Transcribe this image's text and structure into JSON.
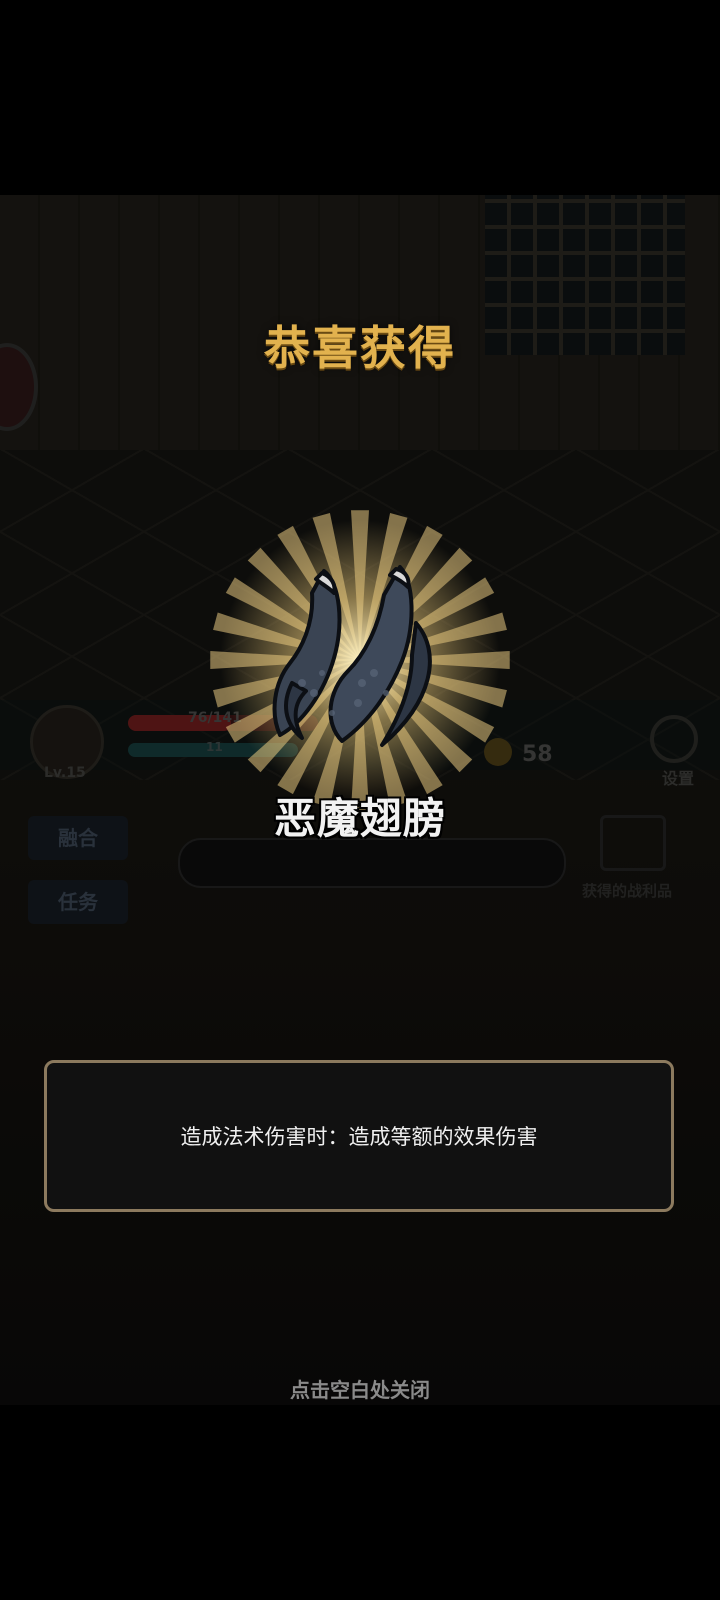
{
  "popup": {
    "title": "恭喜获得",
    "item_name": "恶魔翅膀",
    "item_icon": "demon-wings-icon",
    "description": "造成法术伤害时：造成等额的效果伤害",
    "close_hint": "点击空白处关闭"
  },
  "background_hud": {
    "hp_text": "76/141",
    "mp_text": "11",
    "level": "Lv.15",
    "coins": "58",
    "settings_label": "设置",
    "buttons": [
      "融合",
      "任务"
    ],
    "loot_label": "获得的战利品"
  },
  "colors": {
    "title": "#e2b24e",
    "box_border": "#8c7a5e"
  }
}
